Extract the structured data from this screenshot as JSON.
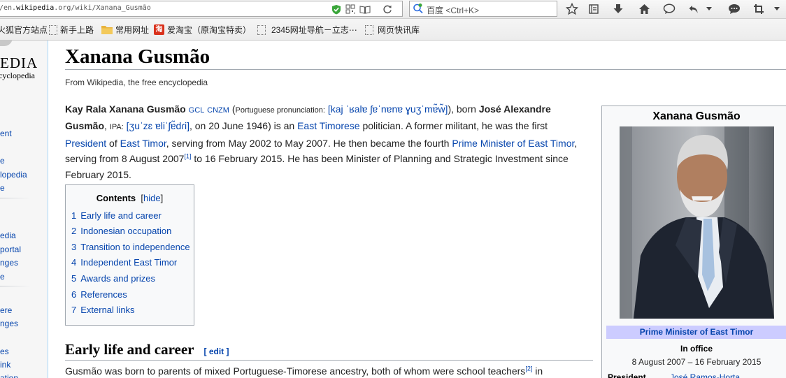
{
  "browser": {
    "url_host_prefix": "/en.",
    "url_host": "wikipedia",
    "url_rest": ".org/wiki/Xanana_Gusmão",
    "search_engine": "百度",
    "search_shortcut": "<Ctrl+K>"
  },
  "bookmarks": [
    {
      "label": "火狐官方站点",
      "icon": "firefox-icon"
    },
    {
      "label": "新手上路",
      "icon": "page-icon"
    },
    {
      "label": "常用网址",
      "icon": "folder-icon"
    },
    {
      "label": "爱淘宝（原淘宝特卖）",
      "icon": "taobao-icon"
    },
    {
      "label": "2345网址导航－立志⋯",
      "icon": "page-icon"
    },
    {
      "label": "网页快讯库",
      "icon": "page-icon"
    }
  ],
  "sidebar": {
    "logo_line1": "EDIA",
    "logo_line2": "ncyclopedia",
    "items": [
      "ent",
      "e",
      "lopedia",
      "e",
      "edia",
      "portal",
      "nges",
      "e",
      "ere",
      "nges",
      "es",
      "ink",
      "ation"
    ]
  },
  "article": {
    "title": "Xanana Gusmão",
    "tagline": "From Wikipedia, the free encyclopedia",
    "lead": {
      "name1": "Kay Rala Xanana Gusmão",
      "gcl": "GCL",
      "cnzm": "CNZM",
      "pron_open": "(",
      "pron_label": "Portuguese pronunciation:",
      "pron_ipa": "[kaj ˈʁalɐ ʃɐˈnɐnɐ ɣuʒˈmɐ̃w̃]",
      "born_text": "), born",
      "name2": "José Alexandre Gusmão",
      "ipa_sep": ",",
      "ipa_label": "IPA:",
      "ipa2": "[ʒuˈzɛ ɐliˈʃɐ̃dɾi]",
      "t1": ", on 20 June 1946) is an",
      "l_east_timorese": "East Timorese",
      "t2": "politician. A former militant, he was the first",
      "l_president": "President",
      "t3": "of",
      "l_east_timor": "East Timor",
      "t4": ", serving from May 2002 to May 2007. He then became the fourth",
      "l_pm": "Prime Minister of East Timor",
      "t5": ", serving from 8 August 2007",
      "ref1": "[1]",
      "t6": "to 16 February 2015. He has been Minister of Planning and Strategic Investment since February 2015."
    },
    "toc": {
      "title": "Contents",
      "hide_open": "[",
      "hide": "hide",
      "hide_close": "]",
      "items": [
        {
          "num": "1",
          "label": "Early life and career"
        },
        {
          "num": "2",
          "label": "Indonesian occupation"
        },
        {
          "num": "3",
          "label": "Transition to independence"
        },
        {
          "num": "4",
          "label": "Independent East Timor"
        },
        {
          "num": "5",
          "label": "Awards and prizes"
        },
        {
          "num": "6",
          "label": "References"
        },
        {
          "num": "7",
          "label": "External links"
        }
      ]
    },
    "section": {
      "title": "Early life and career",
      "edit_open": "[",
      "edit": "edit",
      "edit_close": "]",
      "text": "Gusmão was born to parents of mixed Portuguese-Timorese ancestry, both of whom were school teachers",
      "ref": "[2]",
      "text_end": "in"
    }
  },
  "infobox": {
    "title": "Xanana Gusmão",
    "office": "Prime Minister of East Timor",
    "in_office_label": "In office",
    "dates": "8 August 2007 – 16 February 2015",
    "president_label": "President",
    "president_value": "José Ramos-Horta"
  },
  "colors": {
    "link": "#0645ad",
    "office_band": "#ccccff",
    "sidebar_bg": "#f6f6f6"
  }
}
